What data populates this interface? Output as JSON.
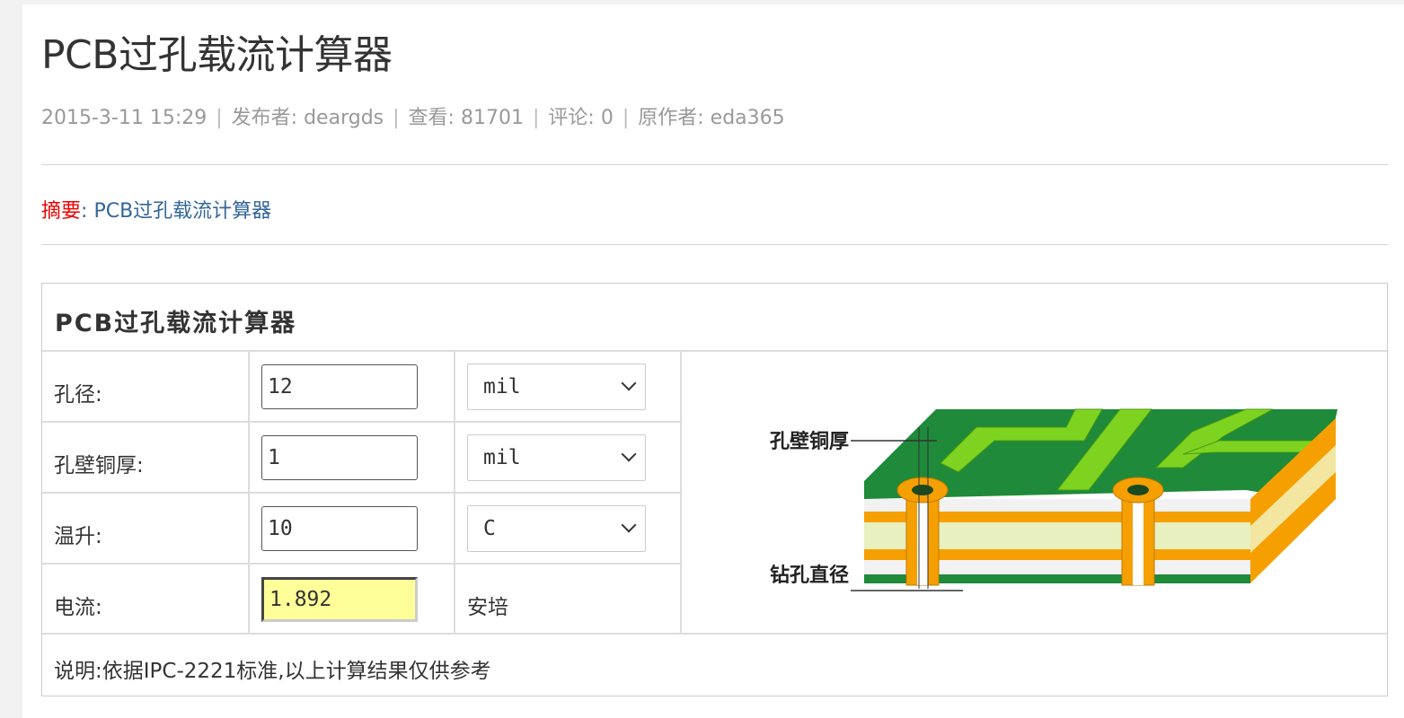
{
  "article": {
    "title": "PCB过孔载流计算器",
    "meta": {
      "date": "2015-3-11 15:29",
      "publisher_label": "发布者:",
      "publisher": "deargds",
      "views_label": "查看:",
      "views": "81701",
      "comments_label": "评论:",
      "comments": "0",
      "author_label": "原作者:",
      "author": "eda365"
    },
    "summary_label": "摘要",
    "summary_colon": ":",
    "summary_text": "PCB过孔载流计算器"
  },
  "calculator": {
    "title": "PCB过孔载流计算器",
    "rows": [
      {
        "label": "孔径:",
        "value": "12",
        "unit": "mil"
      },
      {
        "label": "孔壁铜厚:",
        "value": "1",
        "unit": "mil"
      },
      {
        "label": "温升:",
        "value": "10",
        "unit": "C"
      },
      {
        "label": "电流:",
        "value": "1.892",
        "unit": "安培"
      }
    ],
    "note": "说明:依据IPC-2221标准,以上计算结果仅供参考",
    "diagram": {
      "label_wall": "孔壁铜厚",
      "label_drill": "钻孔直径"
    }
  },
  "colors": {
    "summary_label": "#e00000",
    "summary_link": "#336699",
    "result_bg": "#ffff99",
    "board_green": "#1e8a3a",
    "trace_green": "#7ed321",
    "copper_orange": "#f5a000"
  }
}
